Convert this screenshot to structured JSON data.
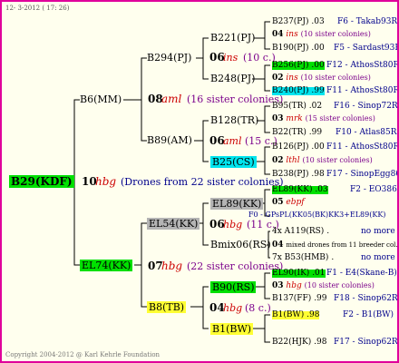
{
  "header": {
    "date": "12- 3-2012 ( 17: 26)"
  },
  "footer": {
    "copyright": "Copyright 2004-2012 @ Karl Kehrle Foundation"
  },
  "root": {
    "id": "B29(KDF)",
    "gen": "10",
    "race": "hbg",
    "note": "(Drones from 22 sister colonies)"
  },
  "b6": {
    "id": "B6(MM)",
    "gen": "08",
    "race": "aml",
    "note": "(16 sister colonies)"
  },
  "b294": {
    "id": "B294(PJ)",
    "gen": "06",
    "race": "ins",
    "note": "(10 c.)"
  },
  "b221": {
    "id": "B221(PJ)"
  },
  "b248": {
    "id": "B248(PJ)"
  },
  "b89": {
    "id": "B89(AM)",
    "gen": "06",
    "race": "aml",
    "note": "(15 c.)"
  },
  "b128": {
    "id": "B128(TR)"
  },
  "b25": {
    "id": "B25(CS)"
  },
  "el74": {
    "id": "EL74(KK)",
    "gen": "07",
    "race": "hbg",
    "note": "(22 sister colonies)"
  },
  "el54": {
    "id": "EL54(KK)",
    "gen": "06",
    "race": "hbg",
    "note": "(11 c.)"
  },
  "el89": {
    "id": "EL89(KK)"
  },
  "bmix": {
    "id": "Bmix06(RS)"
  },
  "b8": {
    "id": "B8(TB)",
    "gen": "04",
    "race": "hbg",
    "note": "(8 c.)"
  },
  "b90": {
    "id": "B90(RS)"
  },
  "b1": {
    "id": "B1(BW)"
  },
  "right": {
    "r1": {
      "id": "B237(PJ)",
      "v": ".03",
      "link": "F6 - Takab93R"
    },
    "r2": {
      "gen": "04",
      "race": "ins",
      "note": "(10 sister colonies)"
    },
    "r3": {
      "id": "B190(PJ)",
      "v": ".00",
      "link": "F5 - Sardast93R"
    },
    "r4": {
      "id": "B256(PJ)",
      "v": ".00",
      "link": "F12 - AthosSt80R"
    },
    "r5": {
      "gen": "02",
      "race": "ins",
      "note": "(10 sister colonies)"
    },
    "r6": {
      "id": "B240(PJ)",
      "v": ".99",
      "link": "F11 - AthosSt80R"
    },
    "r7": {
      "id": "B95(TR)",
      "v": ".02",
      "link": "F16 - Sinop72R"
    },
    "r8": {
      "gen": "03",
      "race": "mrk",
      "note": "(15 sister colonies)"
    },
    "r9": {
      "id": "B22(TR)",
      "v": ".99",
      "link": "F10 - Atlas85R"
    },
    "r10": {
      "id": "B126(PJ)",
      "v": ".00",
      "link": "F11 - AthosSt80R"
    },
    "r11": {
      "gen": "02",
      "race": "lthl",
      "note": "(10 sister colonies)"
    },
    "r12": {
      "id": "B238(PJ)",
      "v": ".98",
      "link": "F17 - SinopEgg86R"
    },
    "r13": {
      "id": "EL89(KK)",
      "v": ".03",
      "link": "F2 - EO386"
    },
    "r14": {
      "gen": "05",
      "race": "ebpf"
    },
    "r15": {
      "text": "F0 - GPsPL(KK05(BK)KK3+EL89(KK)"
    },
    "r16": {
      "id": "4x A119(RS)",
      "v": ".",
      "link": "no more"
    },
    "r17": {
      "gen": "04",
      "note": "mixed drones from 11 breeder col."
    },
    "r18": {
      "id": "7x B53(HMB)",
      "v": ".",
      "link": "no more"
    },
    "r19": {
      "id": "EL90(IK)",
      "v": ".01",
      "link": "F1 - E4(Skane-B)"
    },
    "r20": {
      "gen": "03",
      "race": "hbg",
      "note": "(10 sister colonies)"
    },
    "r21": {
      "id": "B137(FF)",
      "v": ".99",
      "link": "F18 - Sinop62R"
    },
    "r22": {
      "id": "B1(BW)",
      "v": ".98",
      "link": "F2 - B1(BW)"
    },
    "r23": {
      "id": "B22(HJK)",
      "v": ".98",
      "link": "F17 - Sinop62R"
    }
  },
  "colors": {
    "border": "#e0009b",
    "background": "#ffffee",
    "green": "#00e000",
    "cyan": "#00e5ee",
    "yellow": "#ffff33",
    "gray": "#b4b4b4",
    "race_red": "#cc0000",
    "note_purple": "#7b008b",
    "link_blue": "#00008b"
  }
}
